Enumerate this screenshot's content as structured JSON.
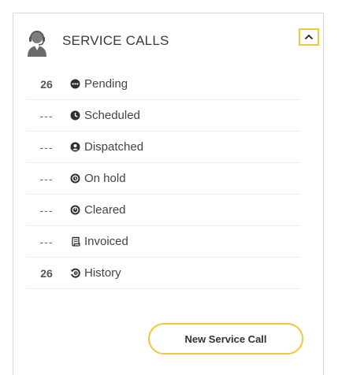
{
  "panel": {
    "title": "SERVICE CALLS",
    "header_icon": "agent-headset-icon",
    "collapse_icon": "chevron-up-icon",
    "accent_color": "#f3c63a"
  },
  "statuses": [
    {
      "count": "26",
      "label": "Pending",
      "icon": "ellipsis-circle-icon"
    },
    {
      "count": "---",
      "label": "Scheduled",
      "icon": "clock-icon"
    },
    {
      "count": "---",
      "label": "Dispatched",
      "icon": "person-circle-icon"
    },
    {
      "count": "---",
      "label": "On hold",
      "icon": "pause-clock-icon"
    },
    {
      "count": "---",
      "label": "Cleared",
      "icon": "check-clock-icon"
    },
    {
      "count": "---",
      "label": "Invoiced",
      "icon": "scroll-icon"
    },
    {
      "count": "26",
      "label": "History",
      "icon": "history-icon"
    }
  ],
  "actions": {
    "new_call_label": "New Service Call"
  }
}
